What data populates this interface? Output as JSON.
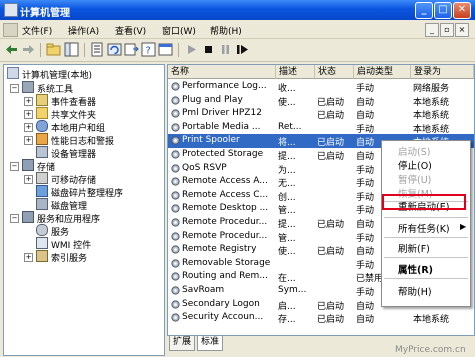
{
  "window": {
    "title": "计算机管理"
  },
  "menu": [
    "文件(F)",
    "操作(A)",
    "查看(V)",
    "窗口(W)",
    "帮助(H)"
  ],
  "tree": [
    {
      "label": "计算机管理(本地)"
    },
    {
      "label": "系统工具"
    },
    {
      "label": "事件查看器"
    },
    {
      "label": "共享文件夹"
    },
    {
      "label": "本地用户和组"
    },
    {
      "label": "性能日志和警报"
    },
    {
      "label": "设备管理器"
    },
    {
      "label": "存储"
    },
    {
      "label": "可移动存储"
    },
    {
      "label": "磁盘碎片整理程序"
    },
    {
      "label": "磁盘管理"
    },
    {
      "label": "服务和应用程序"
    },
    {
      "label": "服务"
    },
    {
      "label": "WMI 控件"
    },
    {
      "label": "索引服务"
    }
  ],
  "columns": [
    "名称",
    "描述",
    "状态",
    "启动类型",
    "登录为"
  ],
  "services": [
    {
      "name": "Performance Log...",
      "desc": "收...",
      "status": "",
      "startup": "手动",
      "logon": "网络服务"
    },
    {
      "name": "Plug and Play",
      "desc": "使...",
      "status": "已启动",
      "startup": "自动",
      "logon": "本地系统"
    },
    {
      "name": "Pml Driver HPZ12",
      "desc": "",
      "status": "已启动",
      "startup": "自动",
      "logon": "本地系统"
    },
    {
      "name": "Portable Media ...",
      "desc": "Ret...",
      "status": "",
      "startup": "手动",
      "logon": "本地系统"
    },
    {
      "name": "Print Spooler",
      "desc": "将...",
      "status": "已启动",
      "startup": "自动",
      "logon": "本地系统"
    },
    {
      "name": "Protected Storage",
      "desc": "提...",
      "status": "已启动",
      "startup": "自动",
      "logon": ""
    },
    {
      "name": "QoS RSVP",
      "desc": "为...",
      "status": "",
      "startup": "手动",
      "logon": ""
    },
    {
      "name": "Remote Access A...",
      "desc": "无...",
      "status": "",
      "startup": "手动",
      "logon": ""
    },
    {
      "name": "Remote Access C...",
      "desc": "创...",
      "status": "",
      "startup": "手动",
      "logon": ""
    },
    {
      "name": "Remote Desktop ...",
      "desc": "管...",
      "status": "",
      "startup": "手动",
      "logon": ""
    },
    {
      "name": "Remote Procedur...",
      "desc": "提...",
      "status": "已启动",
      "startup": "自动",
      "logon": ""
    },
    {
      "name": "Remote Procedur...",
      "desc": "管...",
      "status": "",
      "startup": "手动",
      "logon": ""
    },
    {
      "name": "Remote Registry",
      "desc": "使...",
      "status": "已启动",
      "startup": "自动",
      "logon": ""
    },
    {
      "name": "Removable Storage",
      "desc": "",
      "status": "",
      "startup": "手动",
      "logon": ""
    },
    {
      "name": "Routing and Rem...",
      "desc": "在...",
      "status": "",
      "startup": "已禁用",
      "logon": ""
    },
    {
      "name": "SavRoam",
      "desc": "Sym...",
      "status": "",
      "startup": "手动",
      "logon": ""
    },
    {
      "name": "Secondary Logon",
      "desc": "启...",
      "status": "已启动",
      "startup": "自动",
      "logon": ""
    },
    {
      "name": "Security Accoun...",
      "desc": "存...",
      "status": "已启动",
      "startup": "自动",
      "logon": "本地系统"
    }
  ],
  "selected_service": "Print Spooler",
  "tabs": [
    "扩展",
    "标准"
  ],
  "context_menu": [
    {
      "label": "启动(S)",
      "enabled": false
    },
    {
      "label": "停止(O)",
      "enabled": true
    },
    {
      "label": "暂停(U)",
      "enabled": false
    },
    {
      "label": "恢复(M)",
      "enabled": false
    },
    {
      "label": "重新启动(E)",
      "enabled": true,
      "highlighted": true
    },
    {
      "label": "所有任务(K)",
      "enabled": true,
      "submenu": true
    },
    {
      "label": "刷新(F)",
      "enabled": true
    },
    {
      "label": "属性(R)",
      "enabled": true,
      "bold": true
    },
    {
      "label": "帮助(H)",
      "enabled": true
    }
  ],
  "watermark": "MyPrice.com.cn"
}
